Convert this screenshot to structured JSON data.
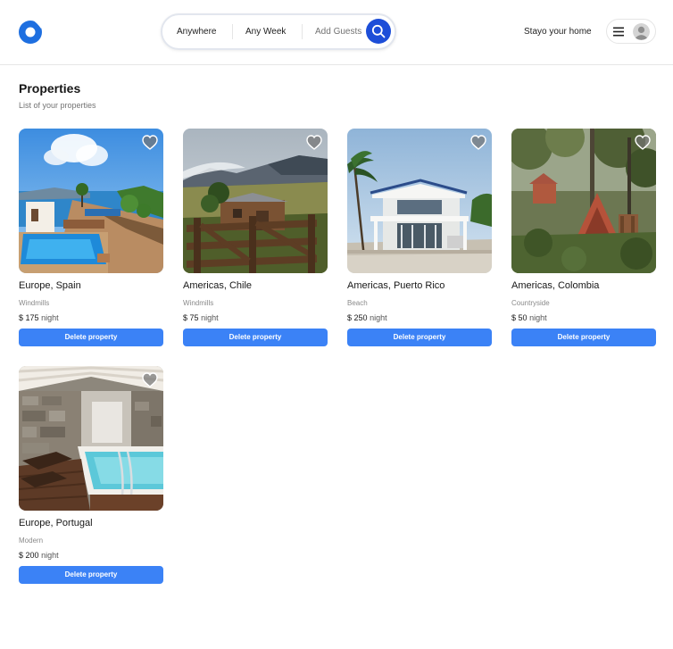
{
  "header": {
    "logo_icon": "airbnb-logo-icon",
    "search": {
      "location_label": "Anywhere",
      "week_label": "Any Week",
      "guests_label": "Add Guests",
      "button_icon": "search-icon"
    },
    "host_link": "Stayo your home",
    "user_menu": {
      "menu_icon": "hamburger-icon",
      "avatar_icon": "avatar-placeholder-icon"
    }
  },
  "page": {
    "title": "Properties",
    "subtitle": "List of your properties"
  },
  "properties": [
    {
      "location": "Europe, Spain",
      "category": "Windmills",
      "currency": "$",
      "price": "175",
      "unit": "night",
      "delete_label": "Delete property",
      "favorite_icon": "heart-icon"
    },
    {
      "location": "Americas, Chile",
      "category": "Windmills",
      "currency": "$",
      "price": "75",
      "unit": "night",
      "delete_label": "Delete property",
      "favorite_icon": "heart-icon"
    },
    {
      "location": "Americas, Puerto Rico",
      "category": "Beach",
      "currency": "$",
      "price": "250",
      "unit": "night",
      "delete_label": "Delete property",
      "favorite_icon": "heart-icon"
    },
    {
      "location": "Americas, Colombia",
      "category": "Countryside",
      "currency": "$",
      "price": "50",
      "unit": "night",
      "delete_label": "Delete property",
      "favorite_icon": "heart-icon"
    },
    {
      "location": "Europe, Portugal",
      "category": "Modern",
      "currency": "$",
      "price": "200",
      "unit": "night",
      "delete_label": "Delete property",
      "favorite_icon": "heart-icon"
    }
  ],
  "colors": {
    "accent": "#3b82f6",
    "search_button": "#1d4ed8",
    "logo": "#1e6fe0"
  }
}
